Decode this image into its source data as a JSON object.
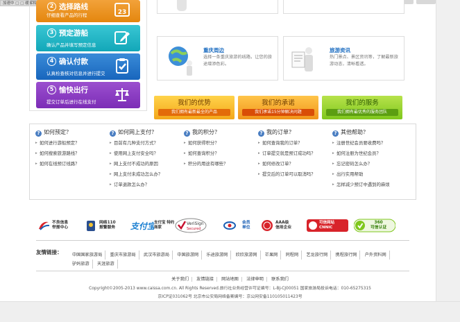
{
  "overlay": {
    "tab_text": "加速中 □ □ 缓解和购旧□"
  },
  "steps": [
    {
      "num": "2",
      "title": "选择路线",
      "desc": "仔细查看产品的行程"
    },
    {
      "num": "3",
      "title": "预定游船",
      "desc": "确认产品并填写预定信息"
    },
    {
      "num": "4",
      "title": "确认付款",
      "desc": "认真检查核对信息并进行提交"
    },
    {
      "num": "5",
      "title": "愉快出行",
      "desc": "提交订单后进行在线支付"
    }
  ],
  "cards": [
    {
      "title": "重庆周边",
      "desc": "选择一条重庆旅游的线路，让您的旅途增添色彩。"
    },
    {
      "title": "旅游资讯",
      "desc": "热门景点、景区资讯等，了解最新旅游动态，清晰看透。"
    }
  ],
  "promises": [
    {
      "title": "我们的优势",
      "sub": "我们拥有最新最全的产品"
    },
    {
      "title": "我们的承诺",
      "sub": "我们承诺15分钟解决问题"
    },
    {
      "title": "我们的服务",
      "sub": "我们拥有最优秀的服务团队"
    }
  ],
  "help": [
    {
      "heading": "如何预定？",
      "items": [
        "如何进行游船预定？",
        "如何搜索旅游路线？",
        "如何在线预订线路？"
      ]
    },
    {
      "heading": "如何网上支付？",
      "items": [
        "目前有几种支付方式？",
        "使用网上支付安全吗？",
        "网上支付不成功的原因",
        "网上支付未成功怎么办？",
        "订单退款怎么办？"
      ]
    },
    {
      "heading": "我的积分？",
      "items": [
        "如何获得积分？",
        "如何查询积分？",
        "积分的用途有哪些？"
      ]
    },
    {
      "heading": "我的订单？",
      "items": [
        "如何查询我的订单？",
        "订单提交就是预订成功吗？",
        "如何修改订单？",
        "提交后的订单可以取消吗？"
      ]
    },
    {
      "heading": "其他帮助？",
      "items": [
        "注册世纪会员要收费吗？",
        "如何注册为世纪会员？",
        "忘记密码怎么办？",
        "出行实用帮助",
        "怎样减少预订中遇到的麻烦"
      ]
    }
  ],
  "badges": [
    {
      "icon": "internet-report-icon",
      "text": "不良信息\n举报中心"
    },
    {
      "icon": "police-icon",
      "text": "网络110\n报警服务"
    },
    {
      "icon": "alipay-icon",
      "text": "支付宝 特约\n商家"
    },
    {
      "icon": "verisign-icon",
      "text": "VeriSign\nSecured"
    },
    {
      "icon": "cnnic-member-icon",
      "text": "会员\n单位"
    },
    {
      "icon": "aaa-credit-icon",
      "text": "AAA级\n信用企业"
    },
    {
      "icon": "cnnic-trust-icon",
      "text": "可信网站\nCNNIC"
    },
    {
      "icon": "360-icon",
      "text": "360\n可信认证"
    }
  ],
  "friends": {
    "label": "友情链接：",
    "links": [
      "中国国家旅游局",
      "重庆市旅游局",
      "武汉市旅游局",
      "中国旅游网",
      "乐途旅游网",
      "欣欣旅游网",
      "芒果网",
      "同程网",
      "艺龙旅行网",
      "携程旅行网",
      "户外资料网",
      "驴妈旅游",
      "天涯旅游"
    ]
  },
  "footer": {
    "links": [
      "关于我们",
      "友情链接",
      "网站地图",
      "法律申明",
      "联系我们"
    ],
    "copyright": "Copyright©2005-2013 www.caissa.com.cn. All Rights Reserved.旅行社业务经营许可证编号：L-BJ-CJ00051 国家旅游局投诉电话：010-65275315",
    "icp": "京ICP证031062号 北京市公安局网络备案编号：京公网安备110105011423号"
  },
  "colors": {
    "orange": "#f2a23a",
    "teal": "#12a7b8",
    "blue": "#1866bd",
    "purple": "#7c2db6",
    "link_blue": "#1b6cc0"
  }
}
